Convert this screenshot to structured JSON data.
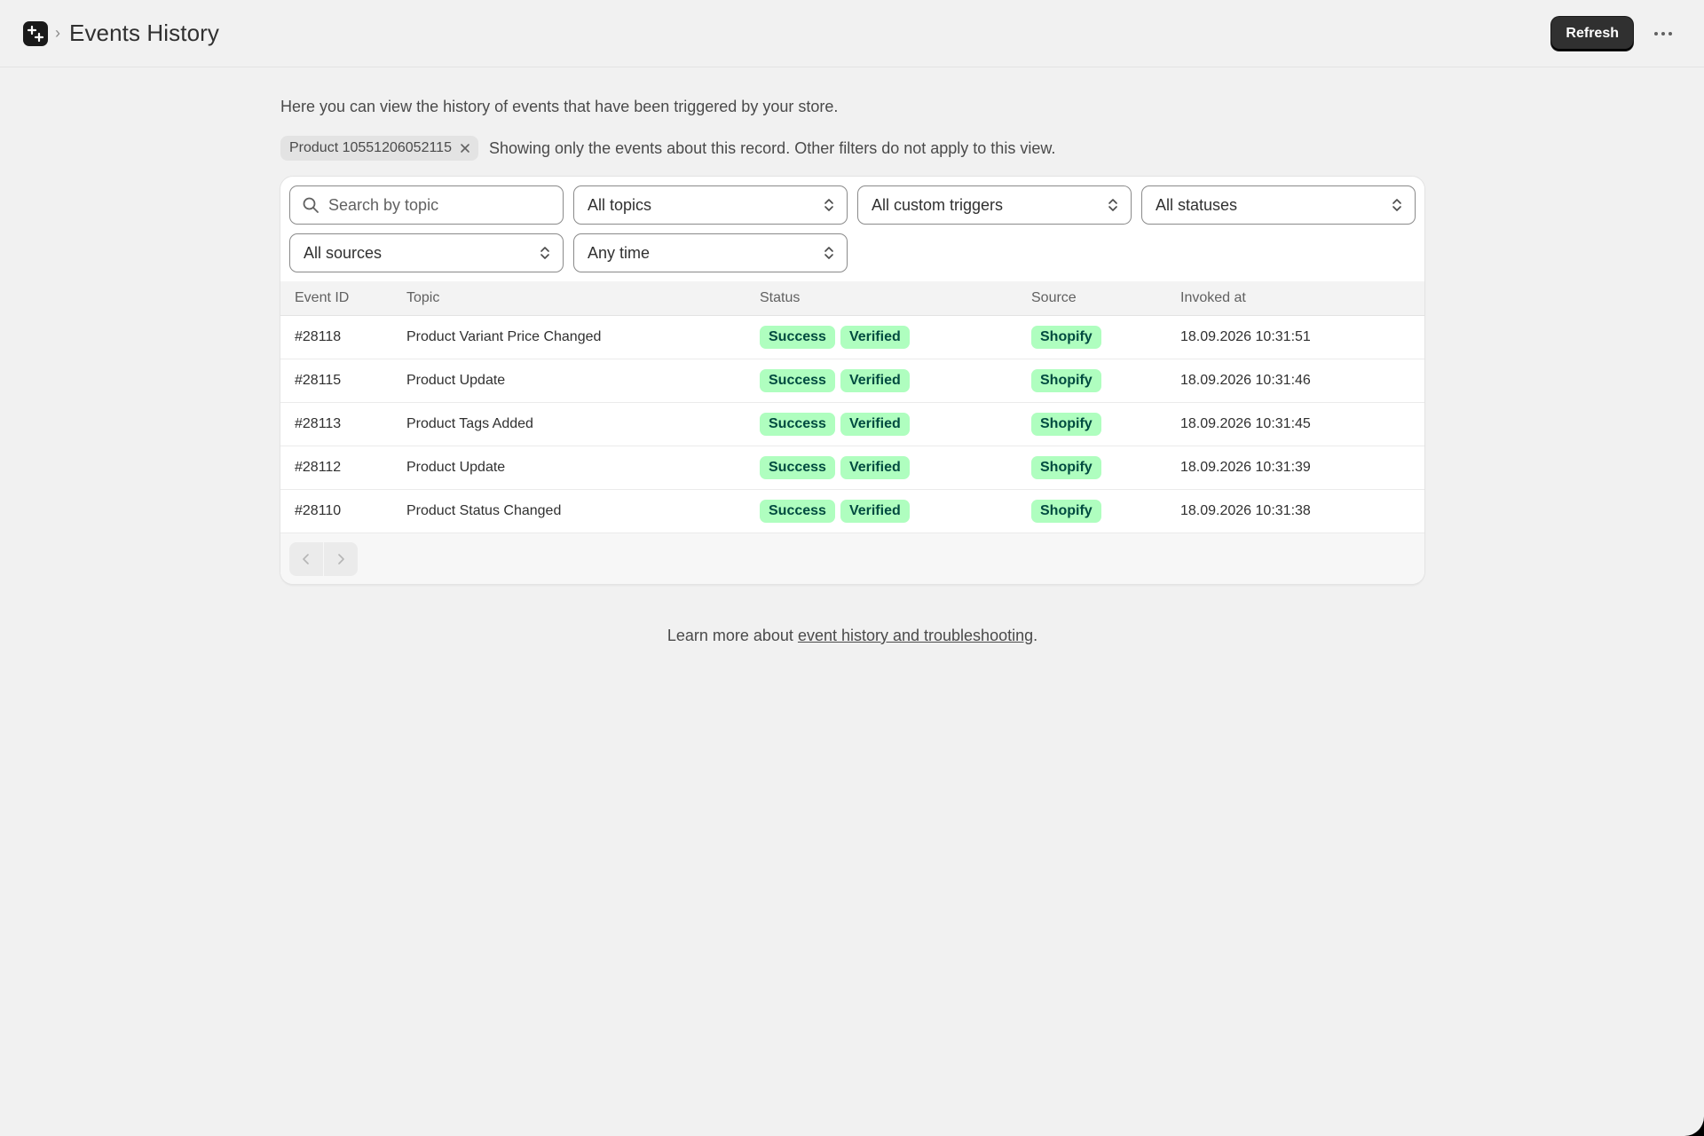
{
  "header": {
    "title": "Events History",
    "refresh_label": "Refresh"
  },
  "intro": "Here you can view the history of events that have been triggered by your store.",
  "record_filter": {
    "chip_label": "Product 10551206052115",
    "note": "Showing only the events about this record. Other filters do not apply to this view."
  },
  "filters": {
    "search_placeholder": "Search by topic",
    "topics": "All topics",
    "custom_triggers": "All custom triggers",
    "statuses": "All statuses",
    "sources": "All sources",
    "time": "Any time"
  },
  "table": {
    "columns": [
      "Event ID",
      "Topic",
      "Status",
      "Source",
      "Invoked at"
    ],
    "rows": [
      {
        "id": "#28118",
        "topic": "Product Variant Price Changed",
        "status": "Success",
        "verification": "Verified",
        "source": "Shopify",
        "invoked_at": "18.09.2026 10:31:51"
      },
      {
        "id": "#28115",
        "topic": "Product Update",
        "status": "Success",
        "verification": "Verified",
        "source": "Shopify",
        "invoked_at": "18.09.2026 10:31:46"
      },
      {
        "id": "#28113",
        "topic": "Product Tags Added",
        "status": "Success",
        "verification": "Verified",
        "source": "Shopify",
        "invoked_at": "18.09.2026 10:31:45"
      },
      {
        "id": "#28112",
        "topic": "Product Update",
        "status": "Success",
        "verification": "Verified",
        "source": "Shopify",
        "invoked_at": "18.09.2026 10:31:39"
      },
      {
        "id": "#28110",
        "topic": "Product Status Changed",
        "status": "Success",
        "verification": "Verified",
        "source": "Shopify",
        "invoked_at": "18.09.2026 10:31:38"
      }
    ]
  },
  "footer": {
    "prefix": "Learn more about ",
    "link": "event history and troubleshooting",
    "suffix": "."
  },
  "colors": {
    "badge_bg": "#affebf",
    "badge_text": "#014b40",
    "primary_button": "#303030"
  },
  "icons": {
    "app": "app-plus-icon",
    "breadcrumb": "chevron-right-icon",
    "more": "ellipsis-horizontal-icon",
    "search": "search-icon",
    "select": "select-chevrons-icon",
    "chip_close": "close-icon",
    "pager_prev": "chevron-left-icon",
    "pager_next": "chevron-right-icon"
  }
}
